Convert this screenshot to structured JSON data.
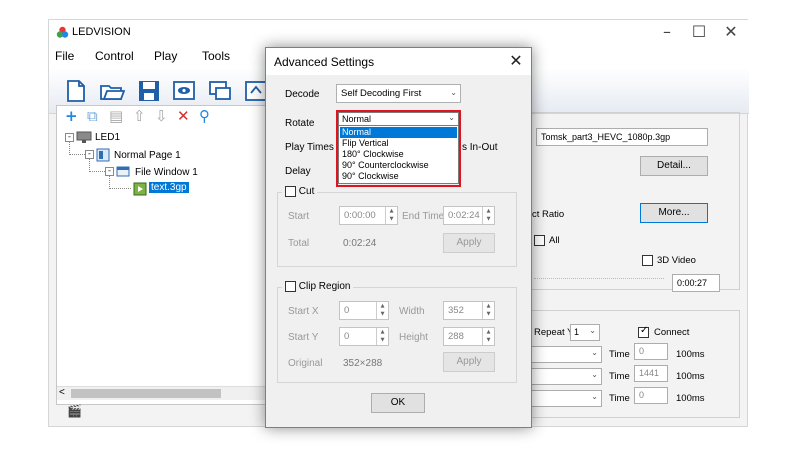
{
  "app": {
    "title": "LEDVISION",
    "window_controls": [
      "minimize-icon",
      "maximize-icon",
      "close-icon"
    ]
  },
  "menu": [
    "File",
    "Control",
    "Play",
    "Tools"
  ],
  "toolbar_icons": [
    "new-file-icon",
    "open-folder-icon",
    "save-icon",
    "preview-icon",
    "send-icon",
    "extra-icon"
  ],
  "tree": {
    "toolbar_icons": [
      "add-icon",
      "copy-icon",
      "paste-icon",
      "move-up-icon",
      "move-down-icon",
      "delete-icon",
      "search-icon"
    ],
    "items": [
      {
        "label": "LED1",
        "icon": "display-icon"
      },
      {
        "label": "Normal Page 1",
        "icon": "page-icon"
      },
      {
        "label": "File Window 1",
        "icon": "window-icon"
      },
      {
        "label": "text.3gp",
        "icon": "video-file-icon",
        "selected": true
      }
    ],
    "scroll_left": "<",
    "status_icon": "clapper-icon"
  },
  "right_panel": {
    "file_name": "Tomsk_part3_HEVC_1080p.3gp",
    "detail_button": "Detail...",
    "aspect_label": "ct Ratio",
    "more_button": "More...",
    "all_label": "All",
    "video3d_label": "3D Video",
    "time_value": "0:00:27",
    "repeat_y_label": "Repeat Y",
    "repeat_y_value": "1",
    "connect_label": "Connect",
    "rows": [
      {
        "time_label": "Time",
        "time_value": "0",
        "unit": "100ms"
      },
      {
        "time_label": "Time",
        "time_value": "1441",
        "unit": "100ms"
      },
      {
        "time_label": "Time",
        "time_value": "0",
        "unit": "100ms"
      }
    ]
  },
  "dialog": {
    "title": "Advanced Settings",
    "decode_label": "Decode",
    "decode_value": "Self Decoding First",
    "rotate_label": "Rotate",
    "rotate_value": "Normal",
    "rotate_options": [
      "Normal",
      "Flip Vertical",
      "180° Clockwise",
      "90° Counterclockwise",
      "90° Clockwise"
    ],
    "play_times_label": "Play Times",
    "play_times_suffix": "s In-Out",
    "delay_label": "Delay",
    "cut": {
      "label": "Cut",
      "start_label": "Start",
      "start_value": "0:00:00",
      "end_label": "End Time",
      "end_value": "0:02:24",
      "total_label": "Total",
      "total_value": "0:02:24",
      "apply": "Apply"
    },
    "clip": {
      "label": "Clip Region",
      "start_x_label": "Start X",
      "start_x_value": "0",
      "width_label": "Width",
      "width_value": "352",
      "start_y_label": "Start Y",
      "start_y_value": "0",
      "height_label": "Height",
      "height_value": "288",
      "original_label": "Original",
      "original_value": "352×288",
      "apply": "Apply"
    },
    "ok": "OK"
  },
  "colors": {
    "accent": "#0078d7",
    "highlight_border": "#e0141e"
  }
}
